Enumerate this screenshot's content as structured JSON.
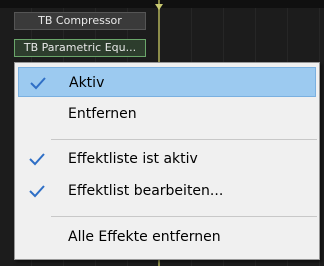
{
  "plugins": {
    "slot1_label": "TB Compressor",
    "slot2_label": "TB Parametric Equ..."
  },
  "menu": {
    "items": [
      {
        "label": "Aktiv",
        "checked": true,
        "highlighted": true
      },
      {
        "label": "Entfernen",
        "checked": false,
        "highlighted": false
      },
      {
        "label": "Effektliste ist aktiv",
        "checked": true,
        "highlighted": false
      },
      {
        "label": "Effektlist bearbeiten...",
        "checked": true,
        "highlighted": false
      },
      {
        "label": "Alle Effekte entfernen",
        "checked": false,
        "highlighted": false
      }
    ]
  },
  "colors": {
    "highlight": "#9ccaf0",
    "check": "#2f6fc6",
    "menu_bg": "#f0f0f0"
  },
  "icons": {
    "check": "check-icon"
  }
}
